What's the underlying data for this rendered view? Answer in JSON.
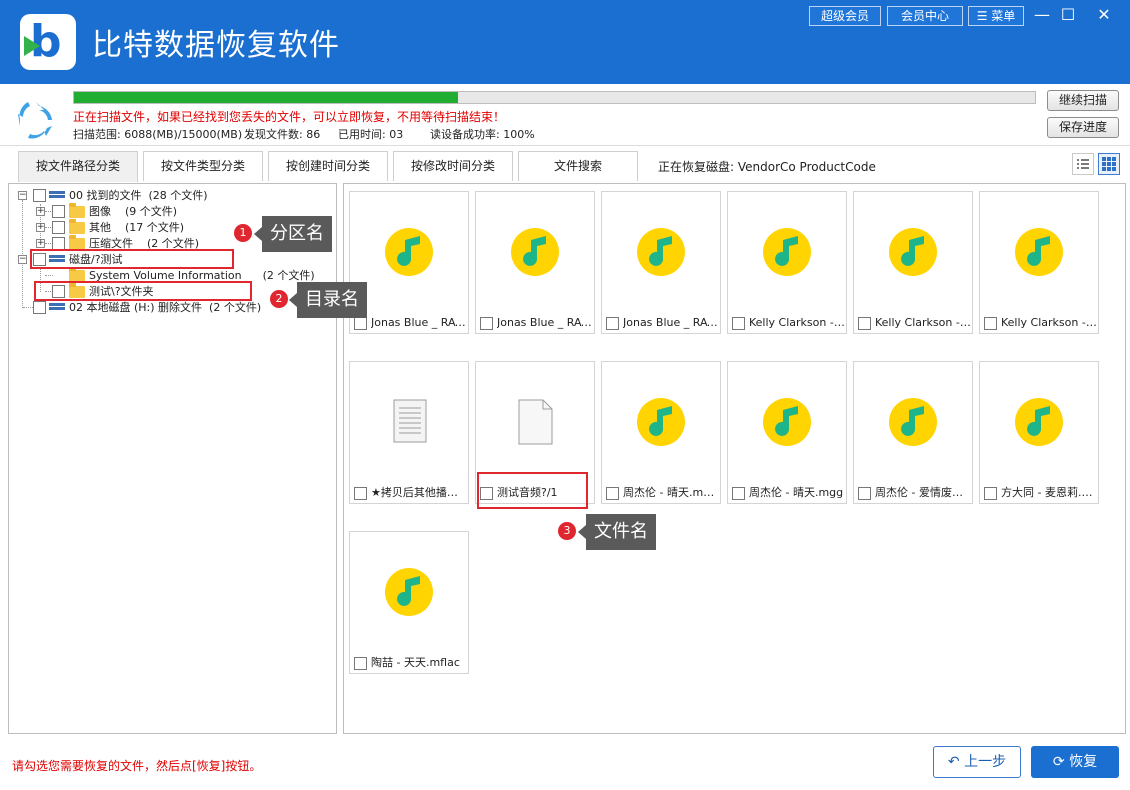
{
  "window": {
    "title": "比特数据恢复软件",
    "buttons": {
      "super_vip": "超级会员",
      "member_center": "会员中心",
      "menu": "菜单"
    },
    "controls": {
      "minimize": "—",
      "maximize": "☐",
      "close": "✕"
    }
  },
  "scan": {
    "progress_percent": 40,
    "message": "正在扫描文件，如果已经找到您丢失的文件，可以立即恢复，不用等待扫描结束！",
    "range": "扫描范围: 6088(MB)/15000(MB)",
    "found": "发现文件数: 86",
    "time": "已用时间: 03",
    "success_rate": "读设备成功率: 100%",
    "continue_btn": "继续扫描",
    "save_btn": "保存进度"
  },
  "tabs": [
    "按文件路径分类",
    "按文件类型分类",
    "按创建时间分类",
    "按修改时间分类",
    "文件搜索"
  ],
  "recovering_disk": "正在恢复磁盘: VendorCo ProductCode",
  "tree": [
    {
      "label": "00 找到的文件",
      "count": "(28 个文件)"
    },
    {
      "label": "图像",
      "count": "(9 个文件)"
    },
    {
      "label": "其他",
      "count": "(17 个文件)"
    },
    {
      "label": "压缩文件",
      "count": "(2 个文件)"
    },
    {
      "label": "磁盘/?测试",
      "count": ""
    },
    {
      "label": "System Volume Information",
      "count": "(2 个文件)"
    },
    {
      "label": "测试\\?文件夹",
      "count": ""
    },
    {
      "label": "02 本地磁盘 (H:) 删除文件",
      "count": "(2 个文件)"
    }
  ],
  "files": [
    {
      "name": "Jonas Blue _ RAYE - By Your Side",
      "type": "music"
    },
    {
      "name": "Jonas Blue _ RAYE - By Your Side",
      "type": "music"
    },
    {
      "name": "Jonas Blue _ RAYE - By Your Side",
      "type": "music"
    },
    {
      "name": "Kelly Clarkson - Catch My Breath",
      "type": "music"
    },
    {
      "name": "Kelly Clarkson - Catch My Breath",
      "type": "music"
    },
    {
      "name": "Kelly Clarkson - Catch My Breath",
      "type": "music"
    },
    {
      "name": "★拷贝后其他播放器",
      "type": "text"
    },
    {
      "name": "测试音频?/1",
      "type": "blank"
    },
    {
      "name": "周杰伦 - 晴天.mflac",
      "type": "music"
    },
    {
      "name": "周杰伦 - 晴天.mgg",
      "type": "music"
    },
    {
      "name": "周杰伦 - 爱情废柴.mflac",
      "type": "music"
    },
    {
      "name": "方大同 - 麦恩莉.mflac",
      "type": "music"
    },
    {
      "name": "陶喆 - 天天.mflac",
      "type": "music"
    }
  ],
  "annotations": {
    "partition": {
      "num": "1",
      "text": "分区名"
    },
    "directory": {
      "num": "2",
      "text": "目录名"
    },
    "filename": {
      "num": "3",
      "text": "文件名"
    }
  },
  "bottom": {
    "hint": "请勾选您需要恢复的文件，然后点[恢复]按钮。",
    "prev_btn": "上一步",
    "recover_btn": "恢复"
  },
  "colors": {
    "brand": "#1a6fd0",
    "progress": "#1fae32",
    "alert": "#e00000",
    "annotation": "#e0262f",
    "music_icon_bg": "#ffd400",
    "music_note": "#1fb58a"
  }
}
